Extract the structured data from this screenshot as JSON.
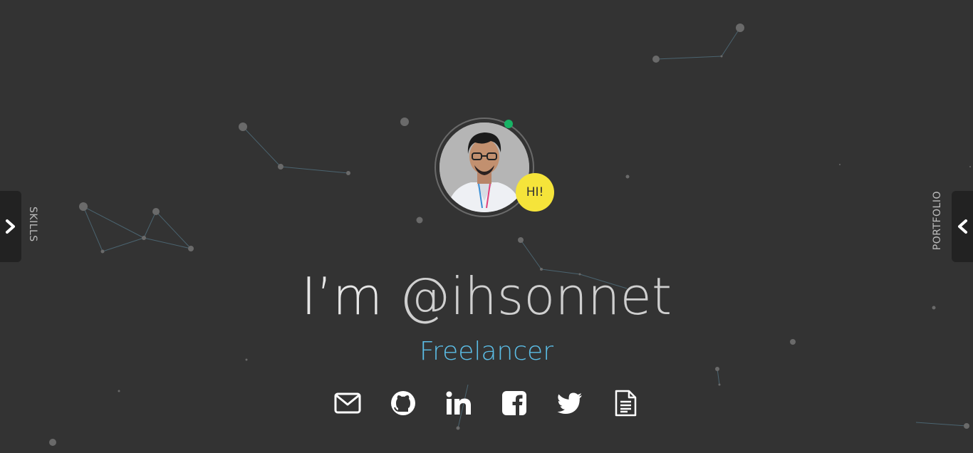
{
  "hero": {
    "intro": "I’m ",
    "handle": "@ihsonnet",
    "role": "Freelancer",
    "badge": "HI!"
  },
  "nav": {
    "left_label": "SKILLS",
    "right_label": "PORTFOLIO"
  },
  "social": [
    {
      "icon": "envelope-icon"
    },
    {
      "icon": "github-icon"
    },
    {
      "icon": "linkedin-icon"
    },
    {
      "icon": "facebook-icon"
    },
    {
      "icon": "twitter-icon"
    },
    {
      "icon": "document-icon"
    }
  ],
  "colors": {
    "background": "#333333",
    "accent": "#5bbde6",
    "badge": "#f5e43a",
    "status": "#17b365"
  }
}
